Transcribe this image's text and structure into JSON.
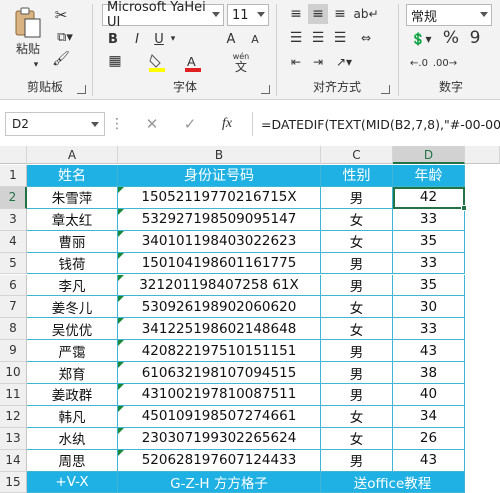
{
  "ribbon": {
    "clipboard": {
      "paste_label": "粘贴",
      "group_label": "剪贴板"
    },
    "font": {
      "font_name": "Microsoft YaHei UI",
      "font_size": "11",
      "bold": "B",
      "italic": "I",
      "underline": "U",
      "grow": "A",
      "shrink": "A",
      "wen": "wén",
      "wen_char": "文",
      "group_label": "字体"
    },
    "alignment": {
      "group_label": "对齐方式"
    },
    "number": {
      "format": "常规",
      "percent": "%",
      "comma": "9",
      "group_label": "数字"
    }
  },
  "formula_bar": {
    "name_box": "D2",
    "fx": "fx",
    "formula": "=DATEDIF(TEXT(MID(B2,7,8),\"#-00-00\"),TODA"
  },
  "columns": [
    "A",
    "B",
    "C",
    "D"
  ],
  "rows": [
    "1",
    "2",
    "3",
    "4",
    "5",
    "6",
    "7",
    "8",
    "9",
    "10",
    "11",
    "12",
    "13",
    "14",
    "15"
  ],
  "header": [
    "姓名",
    "身份证号码",
    "性别",
    "年龄"
  ],
  "table": [
    [
      "朱雪萍",
      "15052119770216715X",
      "男",
      "42"
    ],
    [
      "章太红",
      "532927198509095147",
      "女",
      "33"
    ],
    [
      "曹丽",
      "340101198403022623",
      "女",
      "35"
    ],
    [
      "钱荷",
      "150104198601161775",
      "男",
      "33"
    ],
    [
      "李凡",
      "321201198407258 61X",
      "男",
      "35"
    ],
    [
      "姜冬儿",
      "530926198902060620",
      "女",
      "30"
    ],
    [
      "吴优优",
      "341225198602148648",
      "女",
      "33"
    ],
    [
      "严霭",
      "420822197510151151",
      "男",
      "43"
    ],
    [
      "郑育",
      "610632198107094515",
      "男",
      "38"
    ],
    [
      "姜政群",
      "431002197810087511",
      "男",
      "40"
    ],
    [
      "韩凡",
      "450109198507274661",
      "女",
      "34"
    ],
    [
      "水纨",
      "230307199302265624",
      "女",
      "26"
    ],
    [
      "周思",
      "520628197607124433",
      "男",
      "43"
    ]
  ],
  "footer": [
    "+V-X",
    "G-Z-H  方方格子",
    "送office教程"
  ]
}
